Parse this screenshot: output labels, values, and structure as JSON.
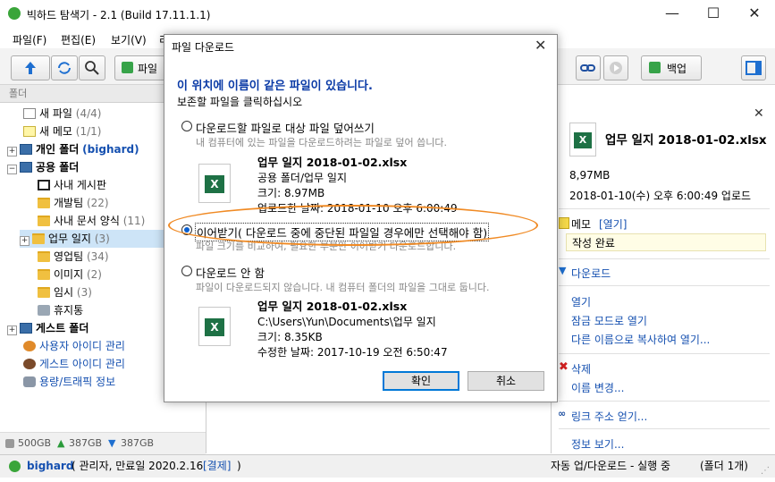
{
  "window": {
    "title": "빅하드 탐색기 - 2.1 (Build 17.11.1.1)",
    "minimize": "—",
    "maximize": "☐",
    "close": "✕"
  },
  "menu": [
    "파일(F)",
    "편집(E)",
    "보기(V)",
    "리"
  ],
  "toolbar": {
    "upload_label": "파일",
    "backup_label": "백업"
  },
  "folder_header": "폴더",
  "tree": {
    "items": [
      {
        "label": "새 파일",
        "count": "(4/4)"
      },
      {
        "label": "새 메모",
        "count": "(1/1)"
      },
      {
        "label": "개인 폴더",
        "extra": "(bighard)"
      },
      {
        "label": "공용 폴더"
      },
      {
        "label": "사내 게시판"
      },
      {
        "label": "개발팀",
        "count": "(22)"
      },
      {
        "label": "사내 문서 양식",
        "count": "(11)"
      },
      {
        "label": "업무 일지",
        "count": "(3)"
      },
      {
        "label": "영업팀",
        "count": "(34)"
      },
      {
        "label": "이미지",
        "count": "(2)"
      },
      {
        "label": "임시",
        "count": "(3)"
      },
      {
        "label": "휴지통"
      },
      {
        "label": "게스트 폴더"
      },
      {
        "label": "사용자 아이디 관리"
      },
      {
        "label": "게스트 아이디 관리"
      },
      {
        "label": "용량/트래픽 정보"
      }
    ]
  },
  "storage": {
    "total": "500GB",
    "up": "387GB",
    "down": "387GB"
  },
  "right_pane": {
    "file_name": "업무 일지 2018-01-02.xlsx",
    "size": "8,97MB",
    "uploaded": "2018-01-10(수) 오후 6:00:49 업로드",
    "memo_label": "메모",
    "memo_open": "[열기]",
    "memo_text": "작성 완료",
    "download": "다운로드",
    "open": "열기",
    "open_locked": "잠금 모드로 열기",
    "copy_as": "다른 이름으로 복사하여 열기...",
    "delete": "삭제",
    "rename": "이름 변경...",
    "get_link": "링크 주소 얻기...",
    "info": "정보 보기..."
  },
  "status": {
    "user": "bighard",
    "role": "( 관리자, 만료일 2020.2.16",
    "pay": "[결제]",
    "close_paren": ")",
    "sync": "자동 업/다운로드 - 실행 중",
    "folders": "(폴더 1개)"
  },
  "dialog": {
    "title": "파일 다운로드",
    "close": "✕",
    "heading": "이 위치에 이름이 같은 파일이 있습니다.",
    "subheading": "보존할 파일을 클릭하십시오",
    "option1": {
      "label": "다운로드할 파일로 대상 파일 덮어쓰기",
      "desc": "내 컴퓨터에 있는 파일을 다운로드하려는 파일로 덮어 씁니다.",
      "file_name": "업무 일지 2018-01-02.xlsx",
      "path": "공용 폴더/업무 일지",
      "size": "크기: 8.97MB",
      "date": "업로드한 날짜: 2018-01-10 오후 6:00:49"
    },
    "option2": {
      "label": "이어받기( 다운로드 중에 중단된 파일일 경우에만 선택해야 함)",
      "desc": "파일 크기를 비교하여, 필요한 부분만 이어받기 다운로드합니다."
    },
    "option3": {
      "label": "다운로드 안 함",
      "desc": "파일이 다운로드되지 않습니다. 내 컴퓨터 폴더의 파일을 그대로 둡니다.",
      "file_name": "업무 일지 2018-01-02.xlsx",
      "path": "C:\\Users\\Yun\\Documents\\업무 일지",
      "size": "크기: 8.35KB",
      "date": "수정한 날짜: 2017-10-19 오전 6:50:47"
    },
    "ok": "확인",
    "cancel": "취소"
  }
}
